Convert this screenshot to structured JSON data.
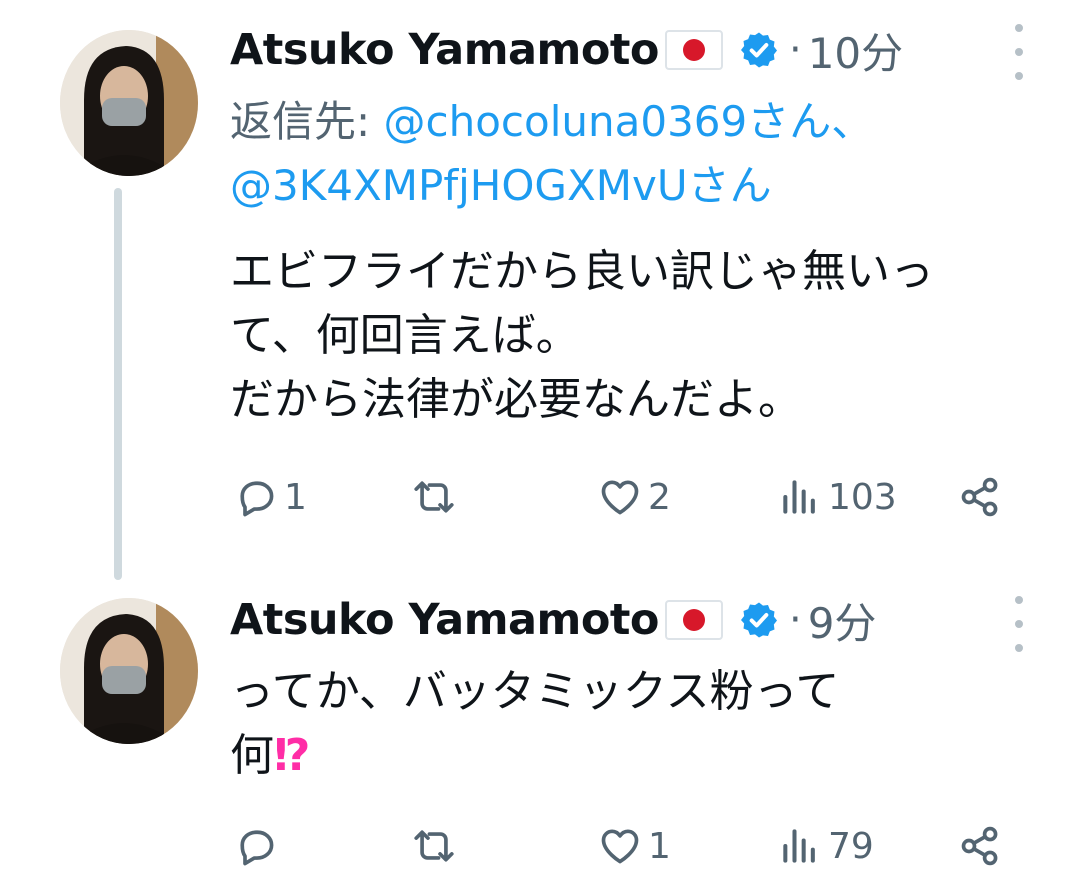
{
  "tweets": [
    {
      "author": "Atsuko Yamamoto",
      "flag_icon": "japan-flag-icon",
      "verified_icon": "verified-badge-icon",
      "separator": "·",
      "time": "10分",
      "reply_prefix": "返信先: ",
      "reply_handle_1": "@chocoluna0369さん、",
      "reply_handle_2": "@3K4XMPfjHOGXMvUさん",
      "text_lines": [
        "エビフライだから良い訳じゃ無いっ",
        "て、何回言えば。",
        "だから法律が必要なんだよ。"
      ],
      "stats": {
        "replies": "1",
        "retweets": "",
        "likes": "2",
        "views": "103"
      }
    },
    {
      "author": "Atsuko Yamamoto",
      "flag_icon": "japan-flag-icon",
      "verified_icon": "verified-badge-icon",
      "separator": "·",
      "time": "9分",
      "text_lines": [
        "ってか、バッタミックス粉って",
        "何"
      ],
      "emoji": "⁉",
      "stats": {
        "replies": "",
        "retweets": "",
        "likes": "1",
        "views": "79"
      }
    }
  ],
  "colors": {
    "link": "#1d9bf0",
    "secondary_text": "#536471",
    "thread_line": "#cfd9de",
    "verified": "#1d9bf0",
    "flag_red": "#d7182a",
    "emoji_pink": "#ff2da6"
  }
}
